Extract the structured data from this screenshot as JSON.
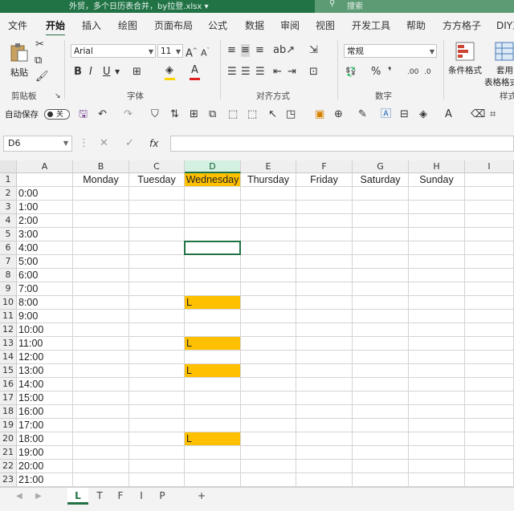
{
  "window": {
    "title": "外贸，多个日历表合并，by拉登.xlsx ▾",
    "search_placeholder": "搜索"
  },
  "menu_tabs": [
    "文件",
    "开始",
    "插入",
    "绘图",
    "页面布局",
    "公式",
    "数据",
    "审阅",
    "视图",
    "开发工具",
    "帮助",
    "方方格子",
    "DIY工"
  ],
  "active_tab": "开始",
  "ribbon": {
    "paste_label": "粘贴",
    "clipboard_group": "剪贴板",
    "font_name": "Arial",
    "font_size": "11",
    "font_group": "字体",
    "alignment_group": "对齐方式",
    "number_format": "常规",
    "number_group": "数字",
    "conditional_format": "条件格式",
    "apply_table_1": "套用",
    "apply_table_2": "表格格式",
    "style_group": "样式",
    "fill_color": "#ffd400",
    "font_color": "#e02020"
  },
  "qat": {
    "autosave_label": "自动保存",
    "autosave_state": "关"
  },
  "formula_bar": {
    "name_box": "D6",
    "fx": "fx",
    "content": ""
  },
  "columns": [
    "A",
    "B",
    "C",
    "D",
    "E",
    "F",
    "G",
    "H",
    "I"
  ],
  "selected_column": "D",
  "day_headers": [
    "Monday",
    "Tuesday",
    "Wednesday",
    "Thursday",
    "Friday",
    "Saturday",
    "Sunday"
  ],
  "times": [
    "0:00",
    "1:00",
    "2:00",
    "3:00",
    "4:00",
    "5:00",
    "6:00",
    "7:00",
    "8:00",
    "9:00",
    "10:00",
    "11:00",
    "12:00",
    "13:00",
    "14:00",
    "15:00",
    "16:00",
    "17:00",
    "18:00",
    "19:00",
    "20:00",
    "21:00"
  ],
  "wednesday_marks": [
    {
      "row": 10,
      "value": "L"
    },
    {
      "row": 13,
      "value": "L"
    },
    {
      "row": 15,
      "value": "L"
    },
    {
      "row": 20,
      "value": "L"
    }
  ],
  "highlight_color": "#ffc000",
  "sheets": [
    "L",
    "T",
    "F",
    "I",
    "P"
  ],
  "active_sheet": "L",
  "add_sheet": "+"
}
